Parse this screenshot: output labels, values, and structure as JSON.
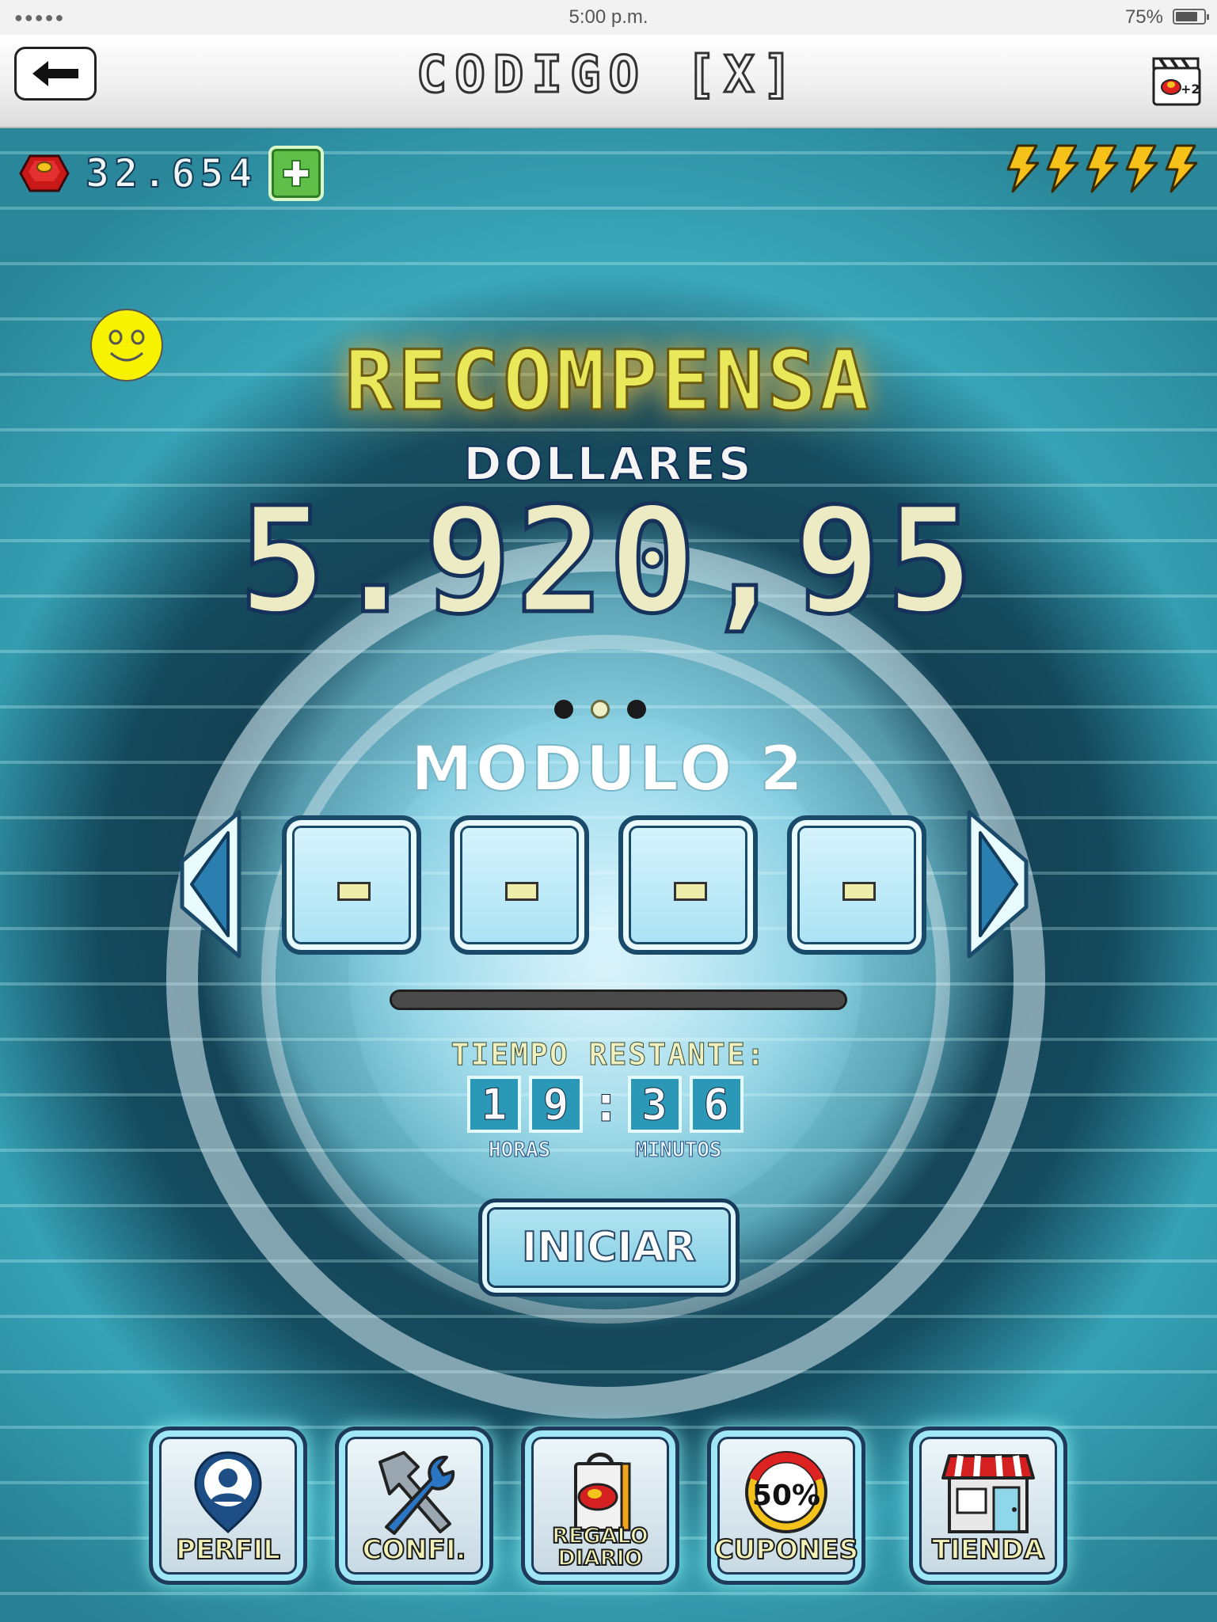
{
  "status_bar": {
    "signal": "●●●●●",
    "time": "5:00 p.m.",
    "battery": "75%"
  },
  "header": {
    "title": "CODIGO [X]"
  },
  "hud": {
    "coins": "32.654",
    "energy_bolts": 5
  },
  "reward": {
    "title": "RECOMPENSA",
    "currency": "DOLLARES",
    "amount": "5.920,95"
  },
  "pager": {
    "pages": 3,
    "active": 1
  },
  "module": {
    "title": "MODULO 2",
    "code_slots": [
      "-",
      "-",
      "-",
      "-"
    ]
  },
  "timer": {
    "label": "TIEMPO RESTANTE:",
    "hours": [
      "1",
      "9"
    ],
    "separator": ":",
    "minutes": [
      "3",
      "6"
    ],
    "hours_label": "HORAS",
    "minutes_label": "MINUTOS"
  },
  "progress": 0,
  "start_button": "INICIAR",
  "nav": [
    {
      "label": "PERFIL",
      "icon": "profile-icon"
    },
    {
      "label": "CONFI.",
      "icon": "tools-icon"
    },
    {
      "label": "REGALO DIARIO",
      "icon": "gift-bag-icon"
    },
    {
      "label": "CUPONES",
      "icon": "coupon-icon",
      "badge": "50%"
    },
    {
      "label": "TIENDA",
      "icon": "shop-icon"
    }
  ],
  "colors": {
    "accent": "#e9e85a",
    "panel": "#a9e2f4",
    "outline": "#1a4a6a"
  }
}
